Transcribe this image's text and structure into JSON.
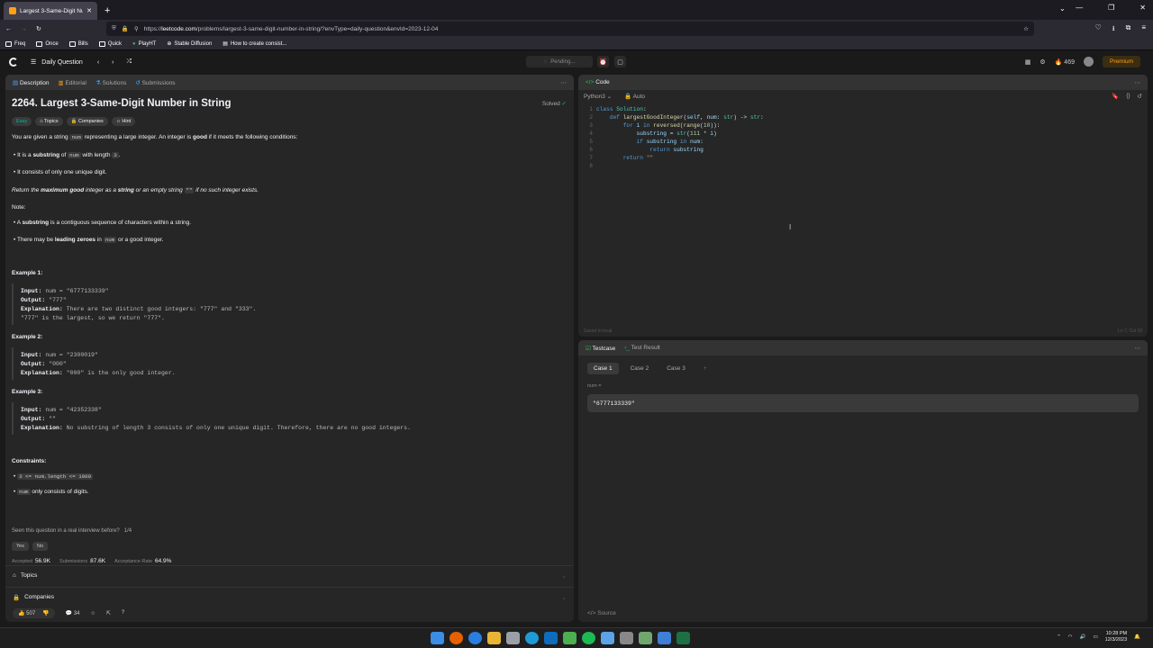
{
  "browser": {
    "tab_title": "Largest 3-Same-Digit Numbe",
    "url_scheme": "https://",
    "url_host": "leetcode.com",
    "url_path": "/problems/largest-3-same-digit-number-in-string/?envType=daily-question&envId=2023-12-04",
    "bookmarks": [
      "Freq",
      "Once",
      "Bills",
      "Quick",
      "PlayHT",
      "Stable Diffusion",
      "How to create consist..."
    ]
  },
  "header": {
    "daily_label": "Daily Question",
    "pending": "Pending...",
    "streak": "469",
    "premium": "Premium"
  },
  "desc_panel": {
    "tabs": [
      "Description",
      "Editorial",
      "Solutions",
      "Submissions"
    ],
    "title": "2264. Largest 3-Same-Digit Number in String",
    "solved": "Solved",
    "tags": [
      "Easy",
      "Topics",
      "Companies",
      "Hint"
    ],
    "intro_a": "You are given a string ",
    "intro_code": "num",
    "intro_b": " representing a large integer. An integer is ",
    "intro_good": "good",
    "intro_c": " if it meets the following conditions:",
    "cond1_a": "It is a ",
    "cond1_b": "substring",
    "cond1_c": " of ",
    "cond1_code": "num",
    "cond1_d": " with length ",
    "cond1_code2": "3",
    "cond1_e": ".",
    "cond2": "It consists of only one unique digit.",
    "ret_a": "Return the ",
    "ret_b": "maximum good",
    "ret_c": " integer as a ",
    "ret_d": "string",
    "ret_e": " or an empty string ",
    "ret_code": "\"\"",
    "ret_f": " if no such integer exists.",
    "note": "Note:",
    "note1_a": "A ",
    "note1_b": "substring",
    "note1_c": " is a contiguous sequence of characters within a string.",
    "note2_a": "There may be ",
    "note2_b": "leading zeroes",
    "note2_c": " in ",
    "note2_code": "num",
    "note2_d": " or a good integer.",
    "ex1_h": "Example 1:",
    "ex1_in": "num = \"6777133339\"",
    "ex1_out": "\"777\"",
    "ex1_exp1": "There are two distinct good integers: \"777\" and \"333\".",
    "ex1_exp2": "\"777\" is the largest, so we return \"777\".",
    "ex2_h": "Example 2:",
    "ex2_in": "num = \"2300019\"",
    "ex2_out": "\"000\"",
    "ex2_exp": "\"000\" is the only good integer.",
    "ex3_h": "Example 3:",
    "ex3_in": "num = \"42352338\"",
    "ex3_out": "\"\"",
    "ex3_exp": "No substring of length 3 consists of only one unique digit. Therefore, there are no good integers.",
    "lbl_input": "Input:",
    "lbl_output": "Output:",
    "lbl_expl": "Explanation:",
    "constraints_h": "Constraints:",
    "con1": "3 <= num.length <= 1000",
    "con2_code": "num",
    "con2": " only consists of digits.",
    "seen": "Seen this question in a real interview before?",
    "seen_count": "1/4",
    "yes": "Yes",
    "no": "No",
    "accepted_l": "Accepted",
    "accepted_v": "56.9K",
    "subs_l": "Submissions",
    "subs_v": "87.6K",
    "rate_l": "Acceptance Rate",
    "rate_v": "64.9%",
    "acc_topics": "Topics",
    "acc_companies": "Companies",
    "likes": "507",
    "comments": "34"
  },
  "code_panel": {
    "title": "Code",
    "lang": "Python3",
    "auto": "Auto",
    "saved": "Saved to local",
    "position": "Ln 7, Col 18"
  },
  "test_panel": {
    "tab_testcase": "Testcase",
    "tab_result": "Test Result",
    "cases": [
      "Case 1",
      "Case 2",
      "Case 3"
    ],
    "var_label": "num =",
    "var_value": "\"6777133339\"",
    "source": "Source"
  },
  "taskbar": {
    "time": "10:28 PM",
    "date": "12/3/2023"
  },
  "colors": {
    "accent": "#ffa116",
    "easy": "#00b8a3",
    "solved": "#2cbb5d"
  }
}
